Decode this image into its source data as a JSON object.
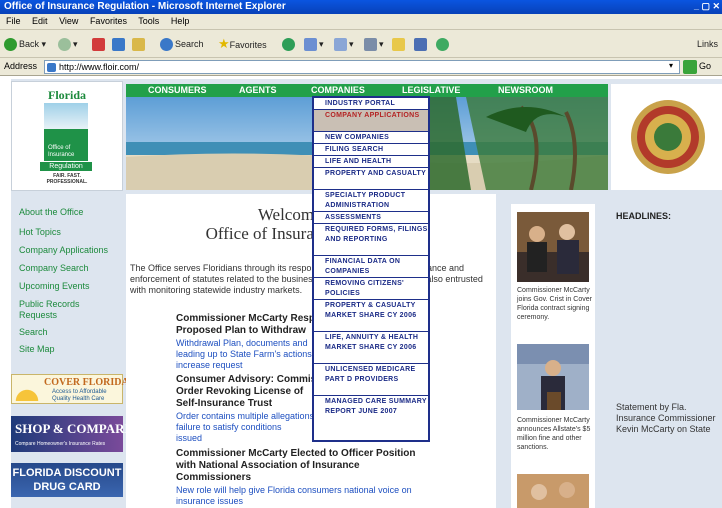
{
  "window": {
    "title": "Office of Insurance Regulation - Microsoft Internet Explorer"
  },
  "menubar": [
    "File",
    "Edit",
    "View",
    "Favorites",
    "Tools",
    "Help"
  ],
  "toolbar": {
    "back": "Back",
    "search": "Search",
    "favorites": "Favorites",
    "links": "Links"
  },
  "address": {
    "label": "Address",
    "url": "http://www.floir.com/",
    "go": "Go"
  },
  "logo": {
    "state": "Florida",
    "line1": "Office of",
    "line2": "Insurance",
    "line3": "Regulation",
    "tagline1": "FAIR. FAST.",
    "tagline2": "PROFESSIONAL."
  },
  "topnav": [
    "CONSUMERS",
    "AGENTS",
    "COMPANIES",
    "LEGISLATIVE",
    "NEWSROOM"
  ],
  "companies_menu": [
    "INDUSTRY PORTAL",
    "COMPANY APPLICATIONS",
    "NEW COMPANIES",
    "FILING SEARCH",
    "LIFE AND HEALTH",
    "PROPERTY AND CASUALTY",
    "SPECIALTY PRODUCT ADMINISTRATION",
    "ASSESSMENTS",
    "REQUIRED FORMS, FILINGS AND REPORTING",
    "FINANCIAL DATA ON COMPANIES",
    "REMOVING CITIZENS' POLICIES",
    "PROPERTY & CASUALTY MARKET SHARE CY 2006",
    "LIFE, ANNUITY & HEALTH MARKET SHARE CY 2006",
    "UNLICENSED MEDICARE PART D PROVIDERS",
    "MANAGED CARE SUMMARY REPORT JUNE 2007"
  ],
  "left_nav": [
    "About the Office",
    "Hot Topics",
    "Company Applications",
    "Company Search",
    "Upcoming Events",
    "Public Records Requests",
    "Search",
    "Site Map"
  ],
  "promos": {
    "cover_title": "COVER FLORIDA",
    "cover_sub1": "Access to Affordable",
    "cover_sub2": "Quality Health Care",
    "shop_compare": "SHOP & COMPARE",
    "shop_sub": "Compare Homeowner's Insurance Rates",
    "drug_card1": "FLORIDA DISCOUNT",
    "drug_card2": "DRUG CARD"
  },
  "main": {
    "welcome1": "Welcome to the",
    "welcome2": "Office of Insurance Regulation",
    "intro": "The Office serves Floridians through its responsibility for regulation, compliance and enforcement of statutes related to the business of insurance. The Office is also entrusted with monitoring statewide industry markets.",
    "news": [
      {
        "headline1": "Commissioner McCarty Responds to",
        "headline2": "Proposed Plan to Withdraw",
        "sub1": "Withdrawal Plan, documents and",
        "sub2": "leading up to State Farm's actions",
        "sub3": "increase request"
      },
      {
        "headline1": "Consumer Advisory: Commissioner",
        "headline2": "Order Revoking License of",
        "headline3": "Self-Insurance Trust",
        "sub1": "Order contains multiple allegations",
        "sub2": "failure to satisfy conditions",
        "sub3": "issued"
      },
      {
        "headline1": "Commissioner McCarty Elected to Officer Position",
        "headline2": "with National Association of Insurance",
        "headline3": "Commissioners",
        "sub1": "New role will help give Florida consumers national voice on",
        "sub2": "insurance issues"
      }
    ]
  },
  "right_col": {
    "cap1": "Commissioner McCarty joins Gov. Crist in Cover Florida contract signing ceremony.",
    "cap2": "Commissioner McCarty announces Allstate's $5 million fine and other sanctions."
  },
  "headlines": {
    "title": "HEADLINES:",
    "statement": "Statement by Fla. Insurance Commissioner Kevin McCarty on State"
  }
}
